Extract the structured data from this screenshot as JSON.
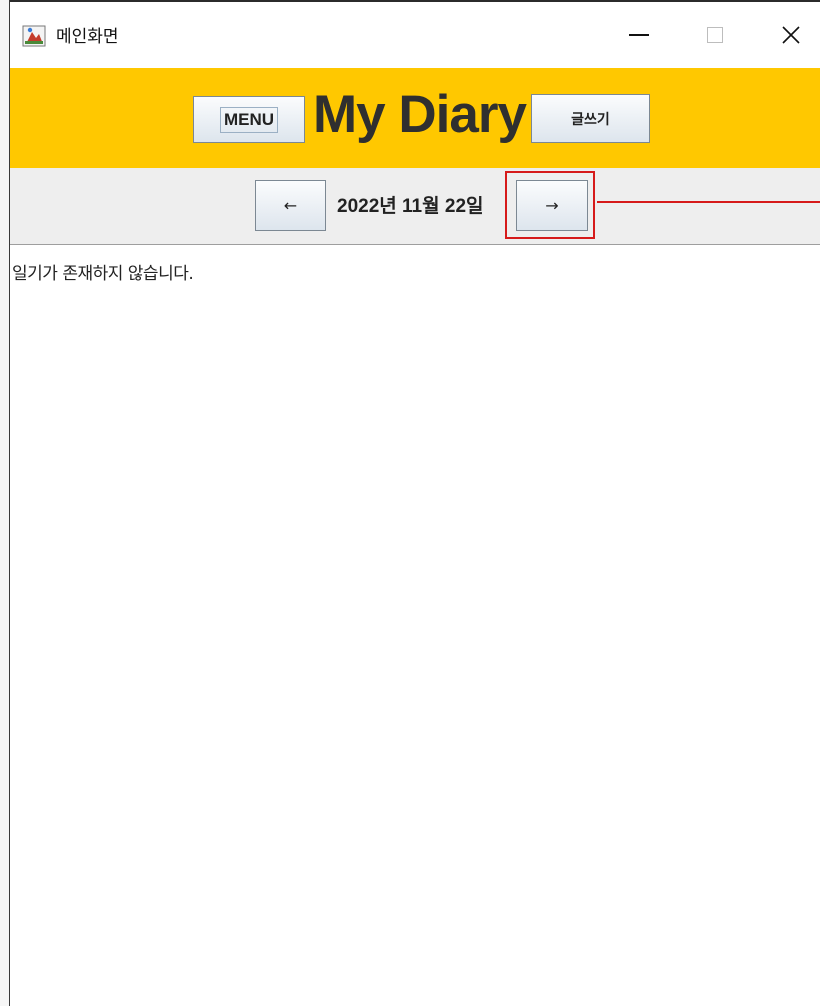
{
  "window": {
    "title": "메인화면",
    "controls": {
      "minimize": "minimize",
      "maximize": "maximize",
      "close": "✕"
    }
  },
  "header": {
    "menu_label": "MENU",
    "app_title": "My Diary",
    "write_label": "글쓰기",
    "background_color": "#ffc800"
  },
  "date_nav": {
    "prev_label": "←",
    "date_text": "2022년 11월 22일",
    "next_label": "→",
    "highlight_color": "#d61a1a"
  },
  "content": {
    "empty_message": "일기가 존재하지 않습니다."
  }
}
